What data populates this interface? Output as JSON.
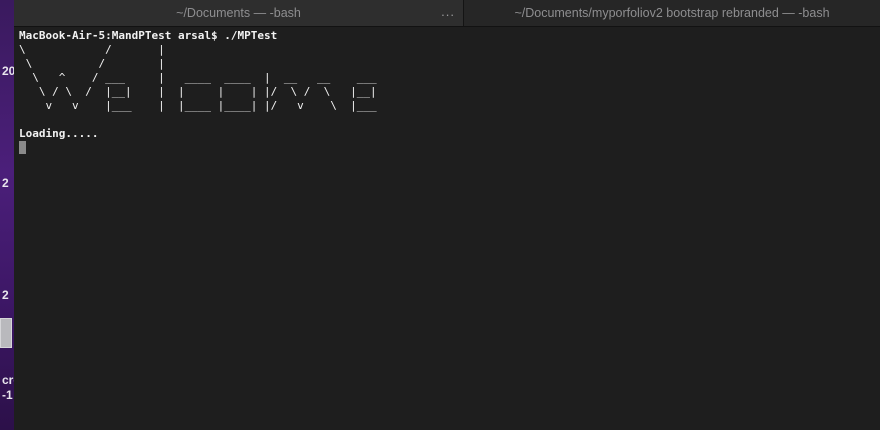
{
  "desktop": {
    "fragments": [
      "20",
      "2",
      "2",
      "cre",
      "-1"
    ]
  },
  "tabs": [
    {
      "label": "~/Documents — -bash",
      "overflow": "..."
    },
    {
      "label": "~/Documents/myporfoliov2 bootstrap rebranded — -bash"
    }
  ],
  "terminal": {
    "prompt": "MacBook-Air-5:MandPTest arsal$ ./MPTest",
    "art": [
      "\\            /       |",
      " \\          /        |",
      "  \\   ^    / ___     |   ____  ____  |  __   __    ___",
      "   \\ / \\  /  |__|    |  |     |    | |/  \\ /  \\   |__|",
      "    v   v    |___    |  |____ |____| |/   v    \\  |___"
    ],
    "loading": "Loading.....",
    "colors": {
      "background": "#1e1e1e",
      "text": "#f2f2f2",
      "cursor": "#8a8a8a"
    }
  }
}
